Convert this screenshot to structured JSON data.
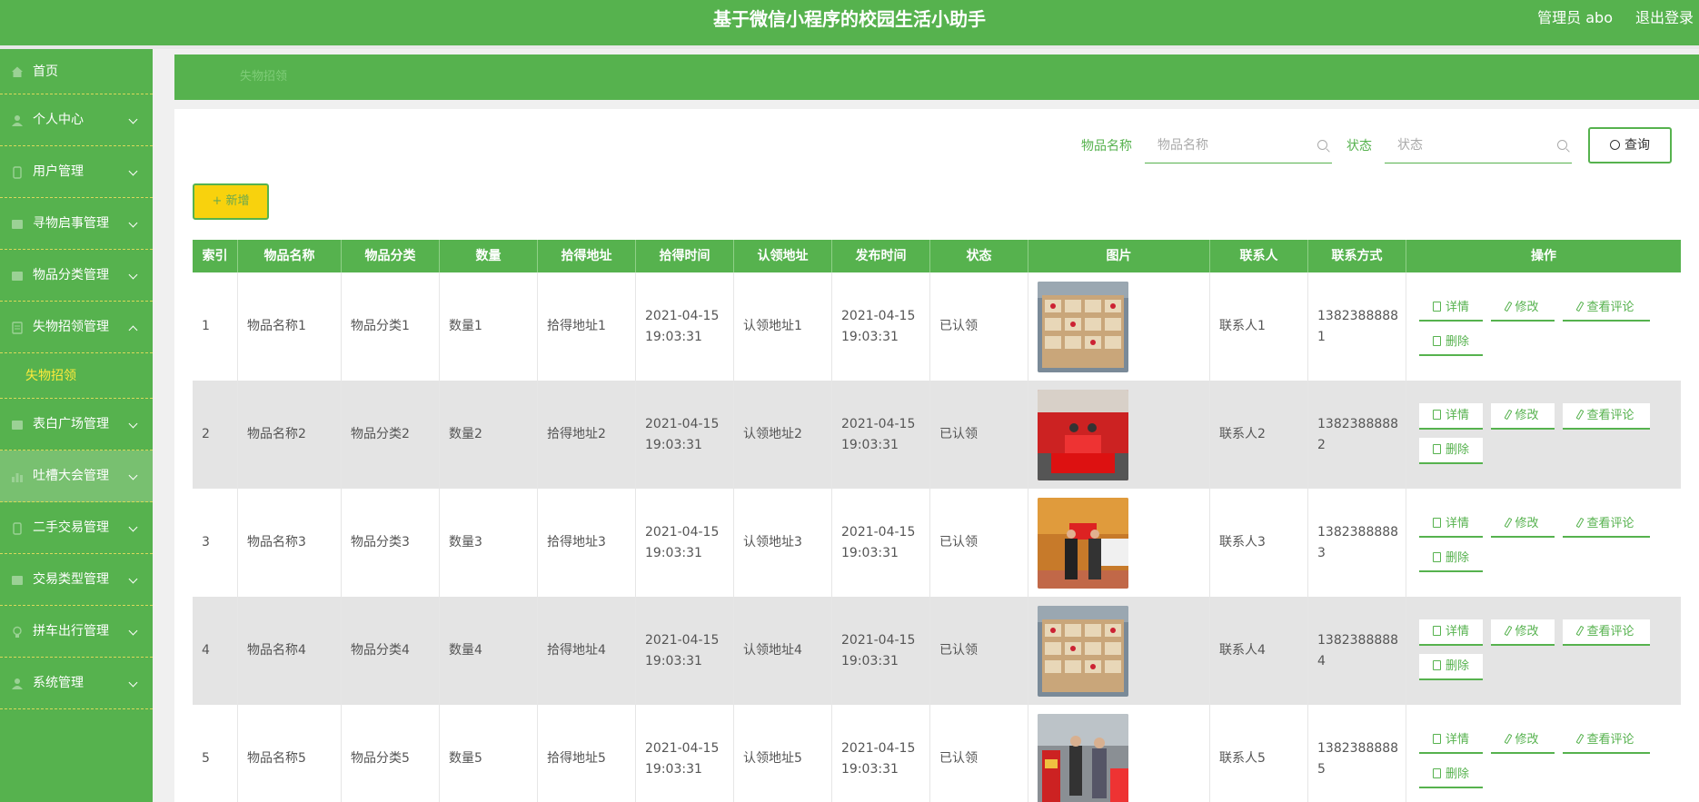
{
  "header": {
    "title": "基于微信小程序的校园生活小助手",
    "user": "管理员 abo",
    "logout": "退出登录"
  },
  "sidebar": {
    "items": [
      {
        "label": "首页",
        "icon": "home-icon"
      },
      {
        "label": "个人中心",
        "icon": "user-icon"
      },
      {
        "label": "用户管理",
        "icon": "phone-icon"
      },
      {
        "label": "寻物启事管理",
        "icon": "grid-icon"
      },
      {
        "label": "物品分类管理",
        "icon": "grid-icon"
      },
      {
        "label": "失物招领管理",
        "icon": "doc-icon"
      },
      {
        "label": "表白广场管理",
        "icon": "grid-icon"
      },
      {
        "label": "吐槽大会管理",
        "icon": "bar-chart-icon"
      },
      {
        "label": "二手交易管理",
        "icon": "phone-icon"
      },
      {
        "label": "交易类型管理",
        "icon": "grid-icon"
      },
      {
        "label": "拼车出行管理",
        "icon": "bulb-icon"
      },
      {
        "label": "系统管理",
        "icon": "user-icon"
      }
    ],
    "submenu": "失物招领"
  },
  "breadcrumb": "失物招领",
  "search": {
    "name_label": "物品名称",
    "name_placeholder": "物品名称",
    "status_label": "状态",
    "status_placeholder": "状态",
    "query_button": "查询"
  },
  "add_button": "+ 新增",
  "table": {
    "headers": [
      "索引",
      "物品名称",
      "物品分类",
      "数量",
      "拾得地址",
      "拾得时间",
      "认领地址",
      "发布时间",
      "状态",
      "图片",
      "联系人",
      "联系方式",
      "操作"
    ],
    "rows": [
      {
        "index": "1",
        "name": "物品名称1",
        "category": "物品分类1",
        "qty": "数量1",
        "found_addr": "拾得地址1",
        "found_time": "2021-04-15 19:03:31",
        "claim_addr": "认领地址1",
        "pub_time": "2021-04-15 19:03:31",
        "status": "已认领",
        "contact": "联系人1",
        "phone": "13823888881"
      },
      {
        "index": "2",
        "name": "物品名称2",
        "category": "物品分类2",
        "qty": "数量2",
        "found_addr": "拾得地址2",
        "found_time": "2021-04-15 19:03:31",
        "claim_addr": "认领地址2",
        "pub_time": "2021-04-15 19:03:31",
        "status": "已认领",
        "contact": "联系人2",
        "phone": "13823888882"
      },
      {
        "index": "3",
        "name": "物品名称3",
        "category": "物品分类3",
        "qty": "数量3",
        "found_addr": "拾得地址3",
        "found_time": "2021-04-15 19:03:31",
        "claim_addr": "认领地址3",
        "pub_time": "2021-04-15 19:03:31",
        "status": "已认领",
        "contact": "联系人3",
        "phone": "13823888883"
      },
      {
        "index": "4",
        "name": "物品名称4",
        "category": "物品分类4",
        "qty": "数量4",
        "found_addr": "拾得地址4",
        "found_time": "2021-04-15 19:03:31",
        "claim_addr": "认领地址4",
        "pub_time": "2021-04-15 19:03:31",
        "status": "已认领",
        "contact": "联系人4",
        "phone": "13823888884"
      },
      {
        "index": "5",
        "name": "物品名称5",
        "category": "物品分类5",
        "qty": "数量5",
        "found_addr": "拾得地址5",
        "found_time": "2021-04-15 19:03:31",
        "claim_addr": "认领地址5",
        "pub_time": "2021-04-15 19:03:31",
        "status": "已认领",
        "contact": "联系人5",
        "phone": "13823888885"
      }
    ],
    "actions": {
      "detail": "详情",
      "edit": "修改",
      "comments": "查看评论",
      "delete": "删除"
    }
  },
  "colors": {
    "primary": "#56b24e",
    "add_button": "#f8d20d",
    "submenu_active": "#ffeb3b"
  }
}
